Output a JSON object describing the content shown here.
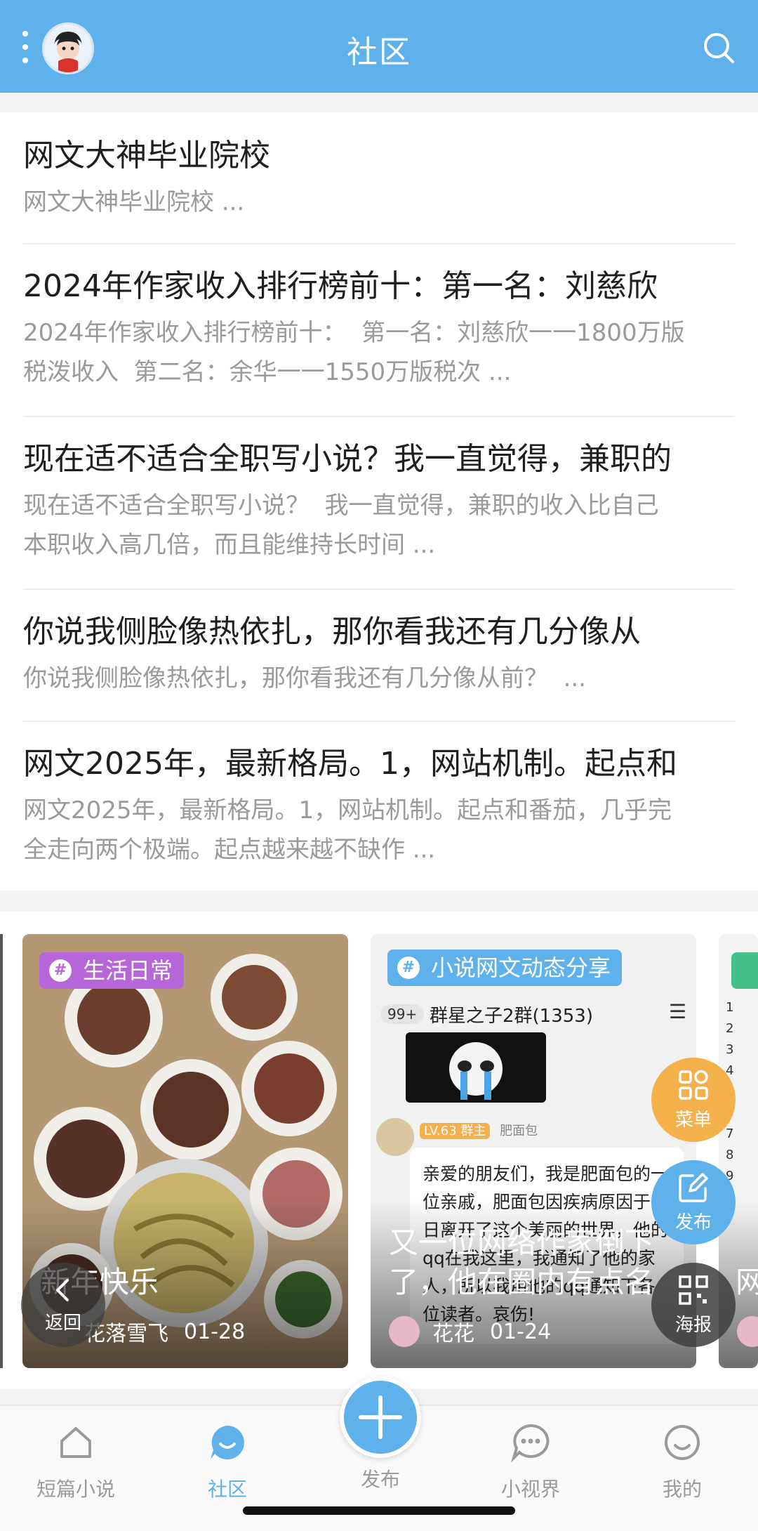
{
  "header": {
    "title": "社区"
  },
  "posts": [
    {
      "title": "网文大神毕业院校",
      "excerpt": "网文大神毕业院校 ..."
    },
    {
      "title": "2024年作家收入排行榜前十：第一名：刘慈欣",
      "excerpt": "2024年作家收入排行榜前十：  第一名：刘慈欣一一1800万版\n税泼收入  第二名：余华一一1550万版税次 ..."
    },
    {
      "title": "现在适不适合全职写小说？我一直觉得，兼职的",
      "excerpt": "现在适不适合全职写小说？  我一直觉得，兼职的收入比自己\n本职收入高几倍，而且能维持长时间 ..."
    },
    {
      "title": "你说我侧脸像热依扎，那你看我还有几分像从",
      "excerpt": "你说我侧脸像热依扎，那你看我还有几分像从前？  ..."
    },
    {
      "title": "网文2025年，最新格局。1，网站机制。起点和",
      "excerpt": "网文2025年，最新格局。1，网站机制。起点和番茄，几乎完\n全走向两个极端。起点越来越不缺作 ..."
    }
  ],
  "cards": [
    {
      "tag": "生活日常",
      "title": "新年快乐",
      "author": "花落雪飞",
      "date": "01-28"
    },
    {
      "tag": "小说网文动态分享",
      "title": "又一位网络作家倒下了，他在圈内有点名",
      "author": "花花",
      "date": "01-24",
      "screenshot_text": {
        "group": "群星之子2群(1353)",
        "badge": "99+",
        "role": "LV.63 群主",
        "sender": "肥面包",
        "message": "亲爱的朋友们，我是肥面包的一位亲戚，肥面包因疾病原因于昨日离开了这个美丽的世界，他的qq在我这里，我通知了他的家人，所以我用他的qq通知下各位读者。哀伤!"
      }
    },
    {
      "tag": "",
      "title": "网",
      "author": "",
      "date": ""
    }
  ],
  "floating": {
    "back_label": "返回",
    "menu_label": "菜单",
    "post_label": "发布",
    "poster_label": "海报"
  },
  "tabs": {
    "short_novel": "短篇小说",
    "community": "社区",
    "publish": "发布",
    "small_vision": "小视界",
    "mine": "我的"
  },
  "colors": {
    "header_bg": "#5fb1eb",
    "tag_life": "#b566d8",
    "tag_novel": "#5fb1eb",
    "fab_menu": "#f4b04a",
    "fab_post": "#5fb1eb",
    "fab_dark": "#3d3d3d"
  }
}
